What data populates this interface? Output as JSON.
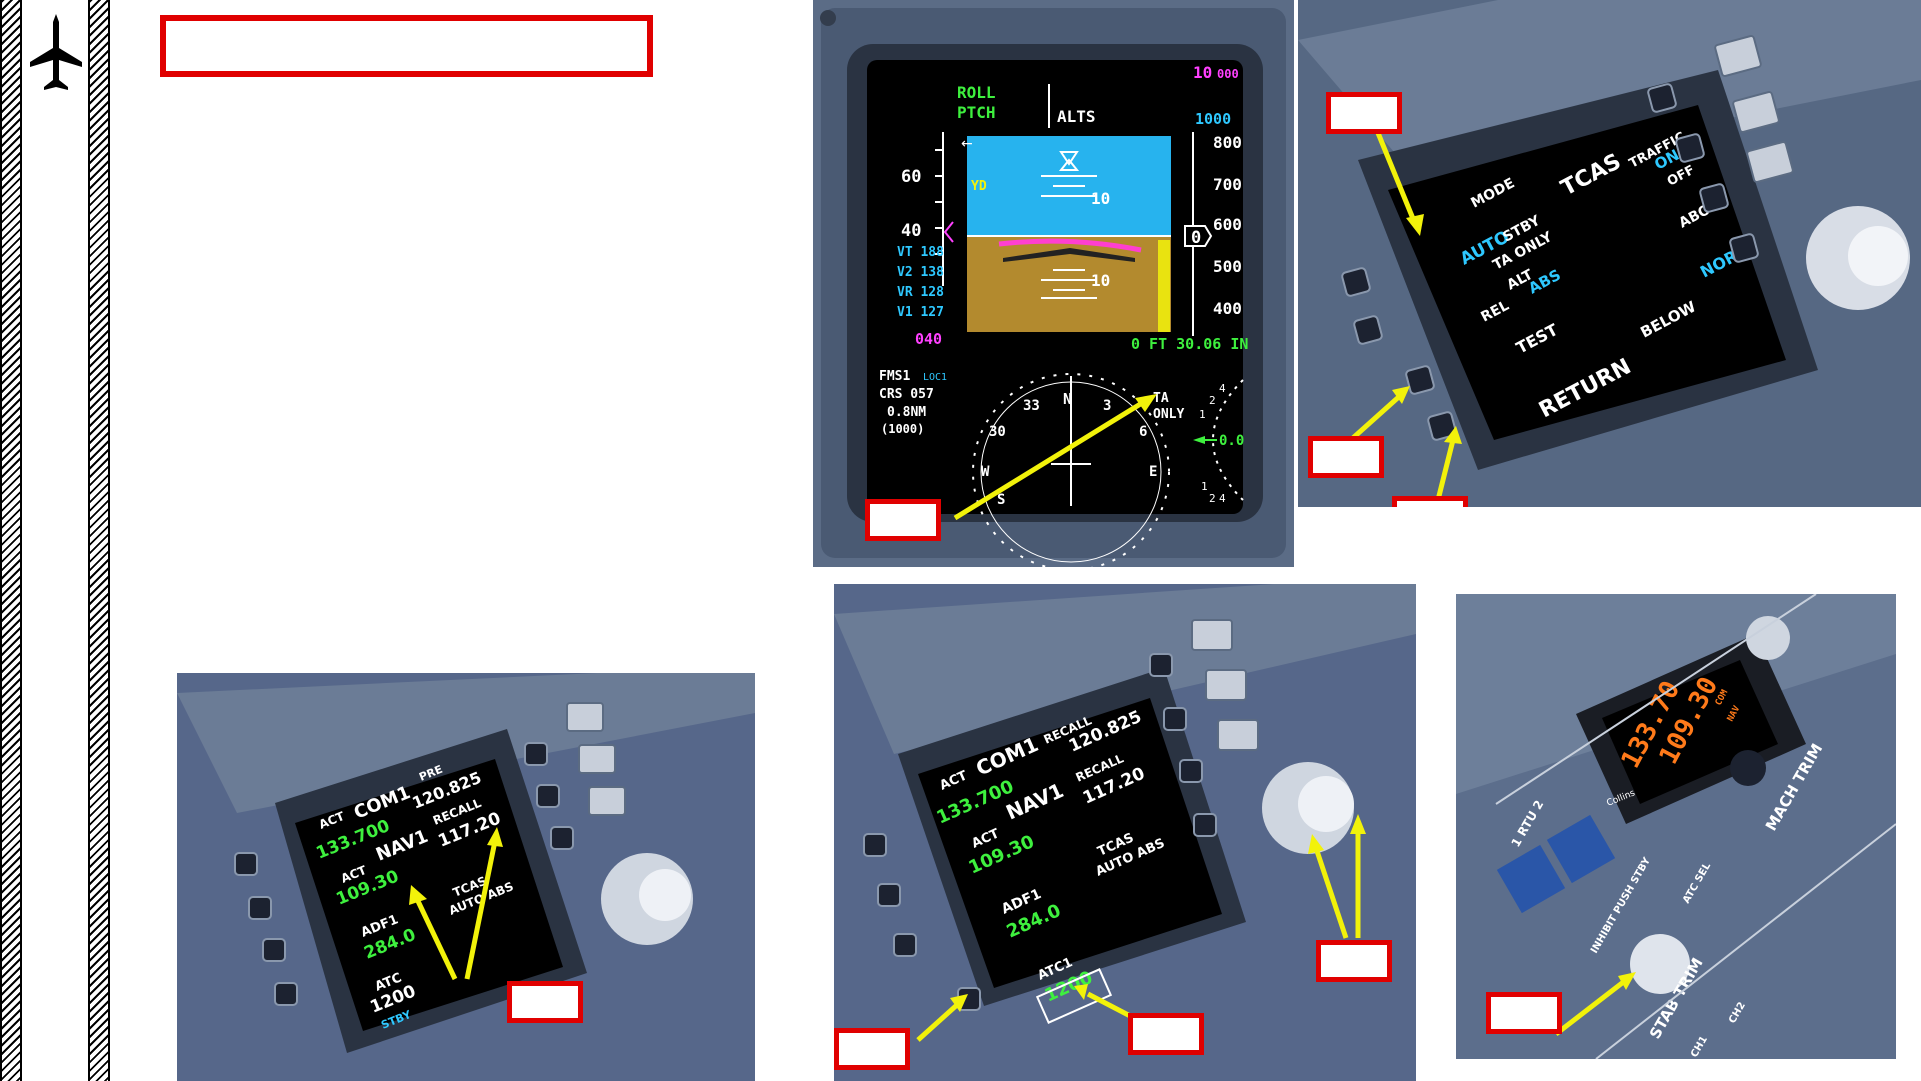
{
  "pfd": {
    "roll": "ROLL",
    "ptch": "PTCH",
    "alts": "ALTS",
    "alt_sel": "10",
    "alt_sel_thousands": "000",
    "baro_min": "1000",
    "speeds": {
      "s60": "60",
      "s40": "40"
    },
    "vspeeds": [
      "VT 188",
      "V2 138",
      "VR 128",
      "V1 127"
    ],
    "mach_ref": "040",
    "yd": "YD",
    "pitch_10_top": "10",
    "pitch_10_bot": "10",
    "alt_tape": [
      "800",
      "700",
      "600",
      "500",
      "400"
    ],
    "alt_zero": "0",
    "baro": "0 FT 30.06 IN",
    "fms": "FMS1",
    "loc": "LOC1",
    "crs": "CRS 057",
    "dist": "0.8NM",
    "alt_cons": "(1000)",
    "ta": "TA",
    "only": "ONLY",
    "compass": [
      "N",
      "33",
      "3",
      "30",
      "6",
      "W",
      "E",
      "S"
    ],
    "vsi": "0.0",
    "vsi_scale": [
      "4",
      "2",
      "1",
      "1",
      "2",
      "4"
    ]
  },
  "tcas_page": {
    "title": "TCAS",
    "traffic": "TRAFFIC",
    "on": "ON",
    "off": "OFF",
    "mode": "MODE",
    "auto": "AUTO",
    "stby": "STBY",
    "ta_only": "TA ONLY",
    "above": "ABOVE",
    "alt": "ALT",
    "abs": "ABS",
    "norm": "NORM",
    "rel": "REL",
    "test": "TEST",
    "below": "BELOW",
    "return": "RETURN"
  },
  "rmu1": {
    "act": "ACT",
    "com1": "COM1",
    "pre": "PRE",
    "pre_freq": "120.825",
    "com_act": "133.700",
    "nav1": "NAV1",
    "recall": "RECALL",
    "nav_recall": "117.20",
    "nav_act": "109.30",
    "tcas": "TCAS",
    "tcas_mode": "AUTO ABS",
    "adf1": "ADF1",
    "adf_freq": "284.0",
    "atc": "ATC",
    "atc_code": "1200",
    "stby": "STBY"
  },
  "rmu2": {
    "act": "ACT",
    "com1": "COM1",
    "recall": "RECALL",
    "com_recall": "120.825",
    "com_act": "133.700",
    "nav1": "NAV1",
    "nav_recall": "117.20",
    "nav_act": "109.30",
    "tcas": "TCAS",
    "tcas_mode": "AUTO ABS",
    "adf1": "ADF1",
    "adf_freq": "284.0",
    "atc1": "ATC1",
    "atc_code": "1200"
  },
  "ctl": {
    "com": "COM",
    "nav": "NAV",
    "freq1": "133.70",
    "freq2": "109.30",
    "collins": "Collins",
    "rtu": "1 RTU 2",
    "inhibit": "INHIBIT PUSH STBY",
    "atc_sel": "ATC SEL",
    "mach_trim": "MACH TRIM",
    "stab_trim": "STAB TRIM",
    "ch1": "CH1",
    "ch2": "CH2"
  },
  "colors": {
    "callout_border": "#e00000",
    "arrow": "#f2f20a",
    "panel": "#5d6f8a"
  }
}
